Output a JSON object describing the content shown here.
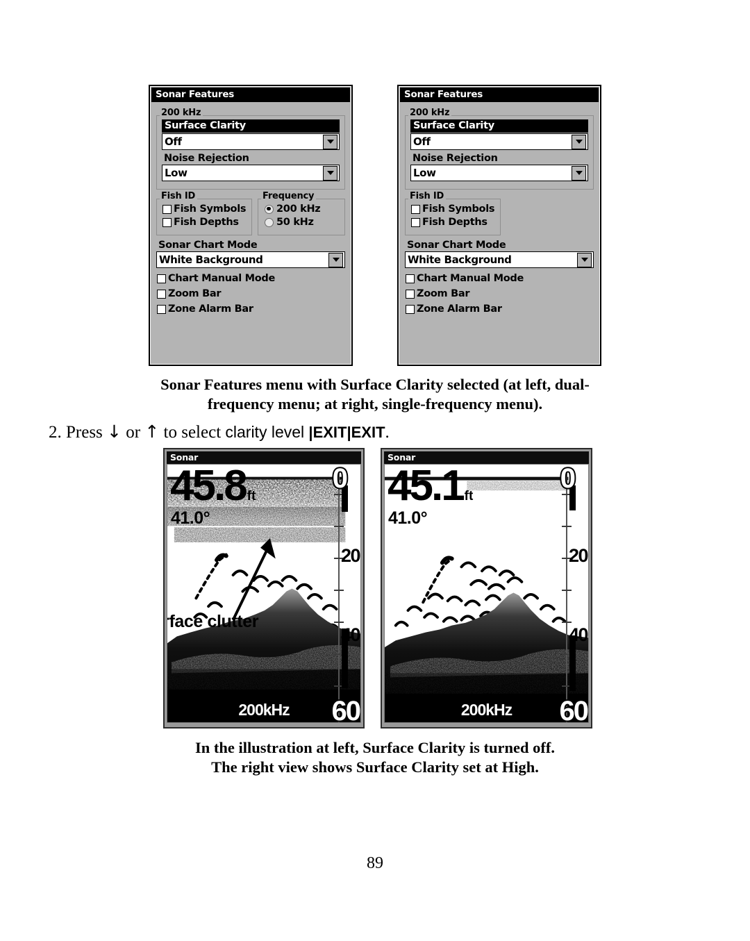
{
  "page": {
    "number": "89"
  },
  "menus": [
    {
      "id": "dual-frequency",
      "title": "Sonar Features",
      "group_200khz": {
        "legend": "200 kHz",
        "surface_clarity_label": "Surface Clarity",
        "surface_clarity_value": "Off",
        "noise_rejection_label": "Noise Rejection",
        "noise_rejection_value": "Low"
      },
      "fish_id": {
        "legend": "Fish ID",
        "items": [
          {
            "label": "Fish Symbols",
            "checked": false
          },
          {
            "label": "Fish Depths",
            "checked": false
          }
        ]
      },
      "frequency": {
        "legend": "Frequency",
        "items": [
          {
            "label": "200 kHz",
            "selected": true
          },
          {
            "label": "50 kHz",
            "selected": false
          }
        ]
      },
      "chart_mode_label": "Sonar Chart Mode",
      "chart_mode_value": "White Background",
      "options": [
        {
          "label": "Chart Manual Mode",
          "checked": false
        },
        {
          "label": "Zoom Bar",
          "checked": false
        },
        {
          "label": "Zone Alarm Bar",
          "checked": false
        }
      ]
    },
    {
      "id": "single-frequency",
      "title": "Sonar Features",
      "group_200khz": {
        "legend": "200 kHz",
        "surface_clarity_label": "Surface Clarity",
        "surface_clarity_value": "Off",
        "noise_rejection_label": "Noise Rejection",
        "noise_rejection_value": "Low"
      },
      "fish_id": {
        "legend": "Fish ID",
        "items": [
          {
            "label": "Fish Symbols",
            "checked": false
          },
          {
            "label": "Fish Depths",
            "checked": false
          }
        ]
      },
      "chart_mode_label": "Sonar Chart Mode",
      "chart_mode_value": "White Background",
      "options": [
        {
          "label": "Chart Manual Mode",
          "checked": false
        },
        {
          "label": "Zoom Bar",
          "checked": false
        },
        {
          "label": "Zone Alarm Bar",
          "checked": false
        }
      ]
    }
  ],
  "caption_top": {
    "line1": "Sonar Features menu with Surface Clarity selected (at left, dual-",
    "line2": "frequency menu; at right, single-frequency menu)."
  },
  "step": {
    "number": "2.",
    "text_a": "Press",
    "arrow_down": "↓",
    "text_or": "or",
    "arrow_up": "↑",
    "text_b": "to select",
    "sans_text": "clarity level",
    "pipe1": "|",
    "key1": "EXIT",
    "pipe2": "|",
    "key2": "EXIT",
    "period": "."
  },
  "sonar_views": [
    {
      "id": "surface-clarity-off",
      "title": "Sonar",
      "depth": "45.8",
      "depth_unit": "ft",
      "temperature": "41.0°",
      "frequency": "200kHz",
      "scale_labels": [
        "0",
        "20",
        "40",
        "60"
      ],
      "annotation": "Surface clutter"
    },
    {
      "id": "surface-clarity-high",
      "title": "Sonar",
      "depth": "45.1",
      "depth_unit": "ft",
      "temperature": "41.0°",
      "frequency": "200kHz",
      "scale_labels": [
        "0",
        "20",
        "40",
        "60"
      ],
      "annotation": ""
    }
  ],
  "caption_bottom": {
    "line1": "In the illustration at left, Surface Clarity is turned off.",
    "line2": "The right view shows Surface Clarity set at High."
  }
}
